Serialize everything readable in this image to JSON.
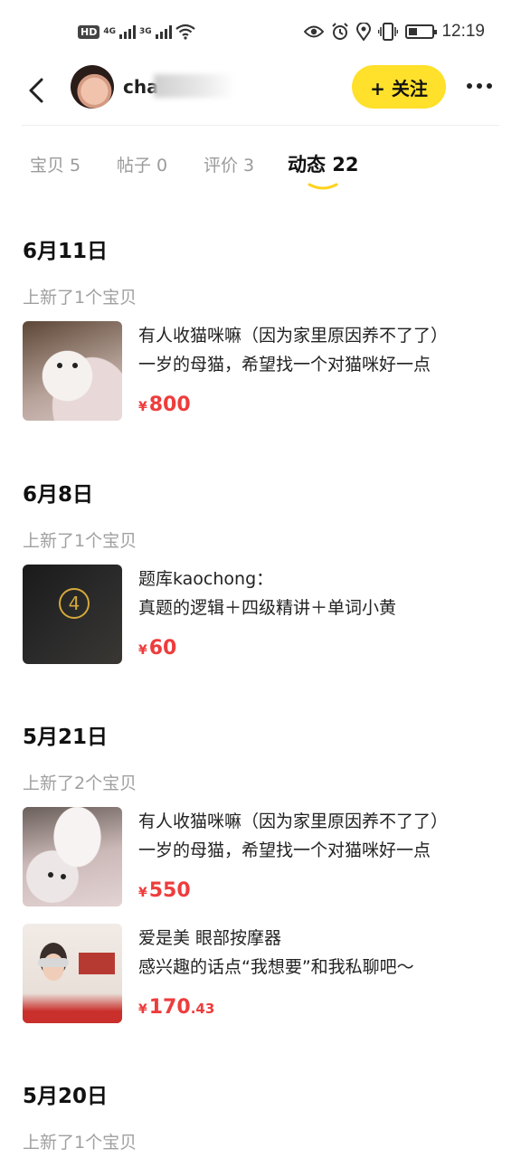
{
  "status_bar": {
    "hd_label": "HD",
    "net_left": "4G",
    "net_right": "3G",
    "time": "12:19",
    "icons": [
      "eye-icon",
      "alarm-icon",
      "location-icon",
      "vibrate-icon",
      "battery-icon"
    ]
  },
  "header": {
    "username": "cha",
    "follow_label": "+ 关注",
    "accent": "#FFE02A"
  },
  "tabs": [
    {
      "label": "宝贝 5",
      "active": false
    },
    {
      "label": "帖子 0",
      "active": false
    },
    {
      "label": "评价 3",
      "active": false
    },
    {
      "label": "动态 22",
      "active": true
    }
  ],
  "feed": [
    {
      "date": "6月11日",
      "subtitle": "上新了1个宝贝",
      "items": [
        {
          "line1": "有人收猫咪嘛（因为家里原因养不了了）",
          "line2": "一岁的母猫，希望找一个对猫咪好一点",
          "currency": "¥",
          "price_int": "800",
          "price_dec": ""
        }
      ]
    },
    {
      "date": "6月8日",
      "subtitle": "上新了1个宝贝",
      "items": [
        {
          "line1": "题库kaochong：",
          "line2": "真题的逻辑＋四级精讲＋单词小黄",
          "currency": "¥",
          "price_int": "60",
          "price_dec": ""
        }
      ]
    },
    {
      "date": "5月21日",
      "subtitle": "上新了2个宝贝",
      "items": [
        {
          "line1": "有人收猫咪嘛（因为家里原因养不了了）",
          "line2": "一岁的母猫，希望找一个对猫咪好一点",
          "currency": "¥",
          "price_int": "550",
          "price_dec": ""
        },
        {
          "line1": "爱是美 眼部按摩器",
          "line2": "感兴趣的话点“我想要”和我私聊吧～",
          "currency": "¥",
          "price_int": "170",
          "price_dec": ".43"
        }
      ]
    },
    {
      "date": "5月20日",
      "subtitle": "上新了1个宝贝",
      "items": []
    }
  ],
  "price_color": "#EE3C3C"
}
